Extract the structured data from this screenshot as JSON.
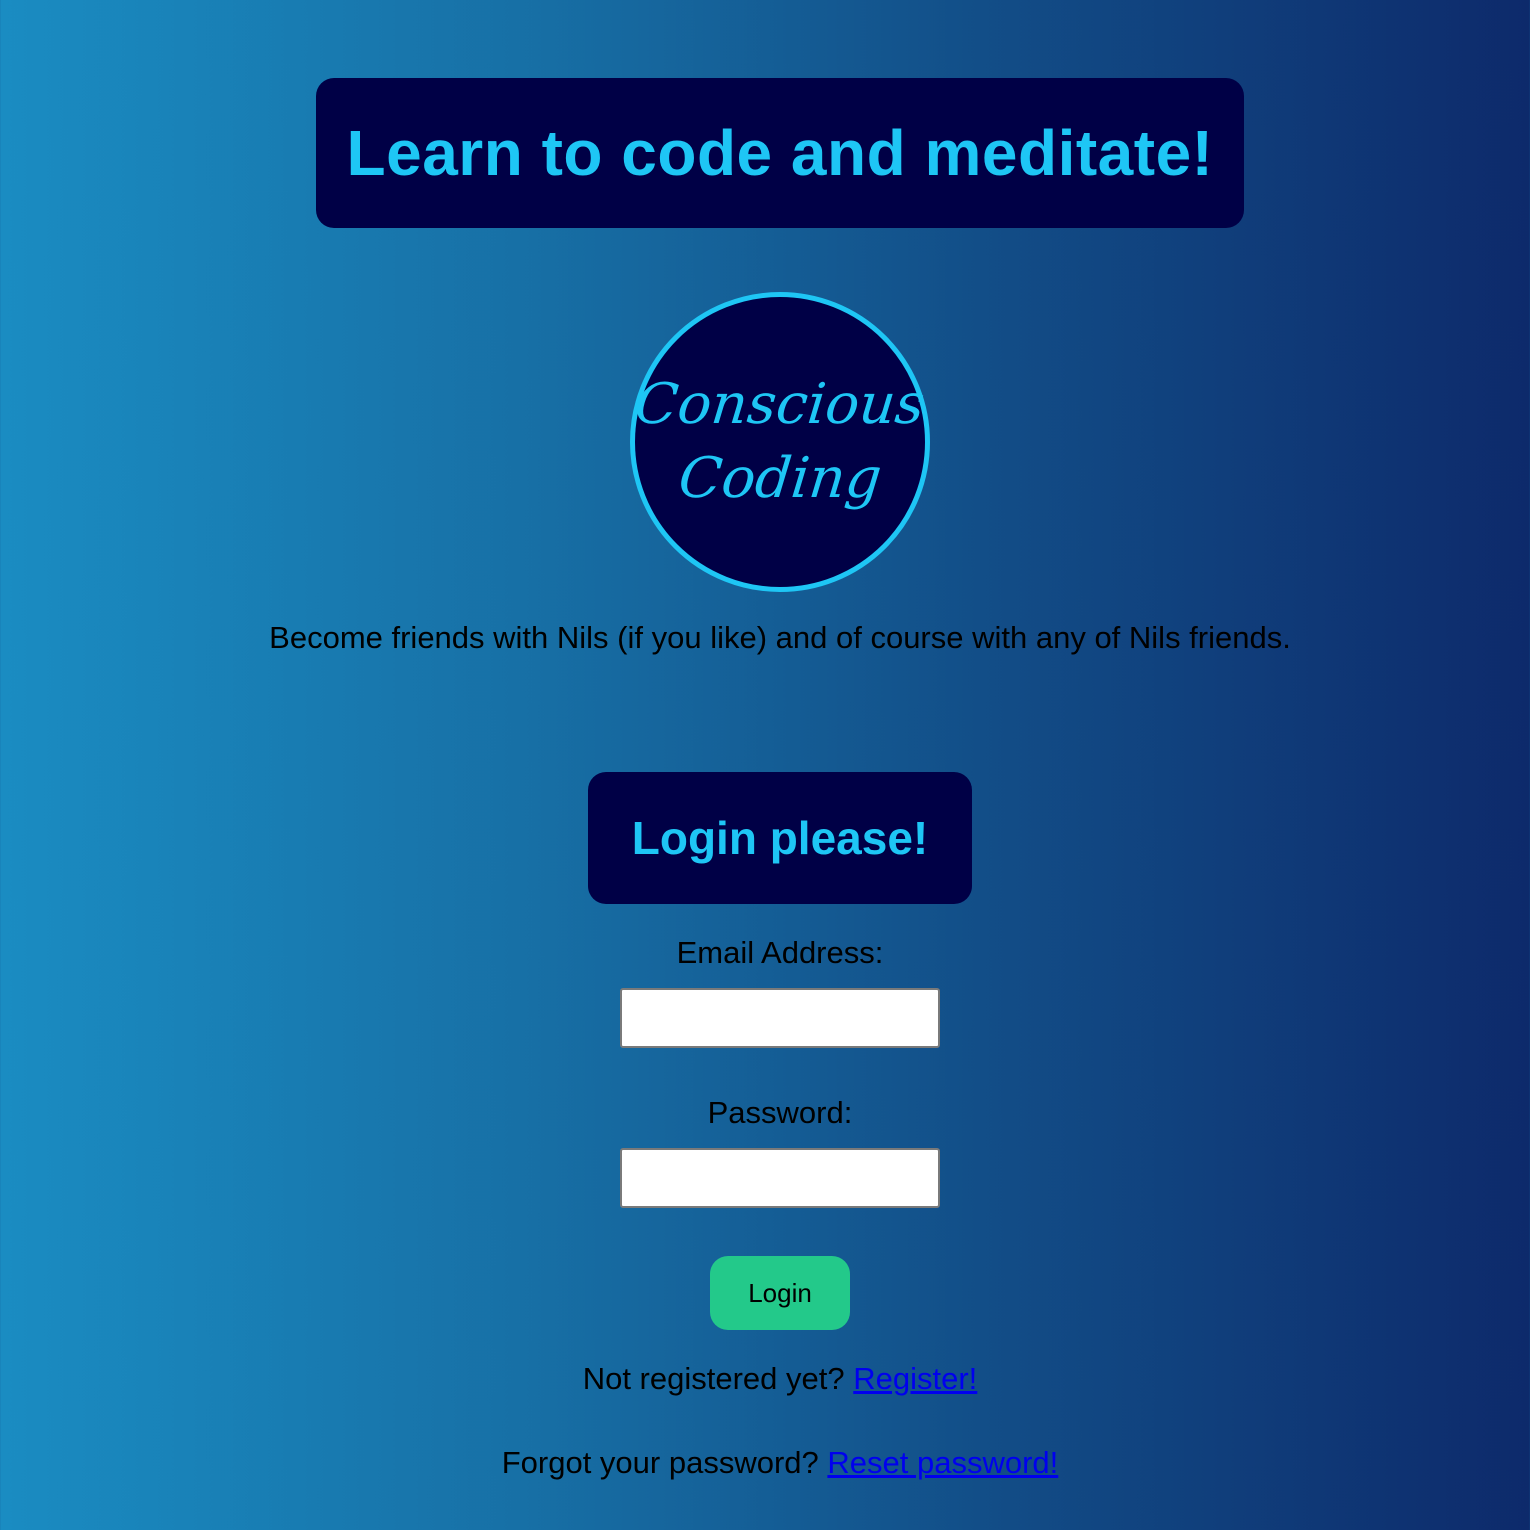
{
  "hero": {
    "title": "Learn to code and meditate!"
  },
  "logo": {
    "line1": "Conscious",
    "line2": "Coding"
  },
  "tagline": "Become friends with Nils (if you like) and of course with any of Nils friends.",
  "login": {
    "heading": "Login please!",
    "email_label": "Email Address:",
    "email_value": "",
    "password_label": "Password:",
    "password_value": "",
    "button_label": "Login"
  },
  "register": {
    "prompt": "Not registered yet?",
    "link": "Register!"
  },
  "reset": {
    "prompt": "Forgot your password?",
    "link": "Reset password!"
  },
  "colors": {
    "banner_bg": "#000046",
    "accent": "#1ec6f5",
    "button_bg": "#23c98a",
    "link": "#0000ee"
  }
}
